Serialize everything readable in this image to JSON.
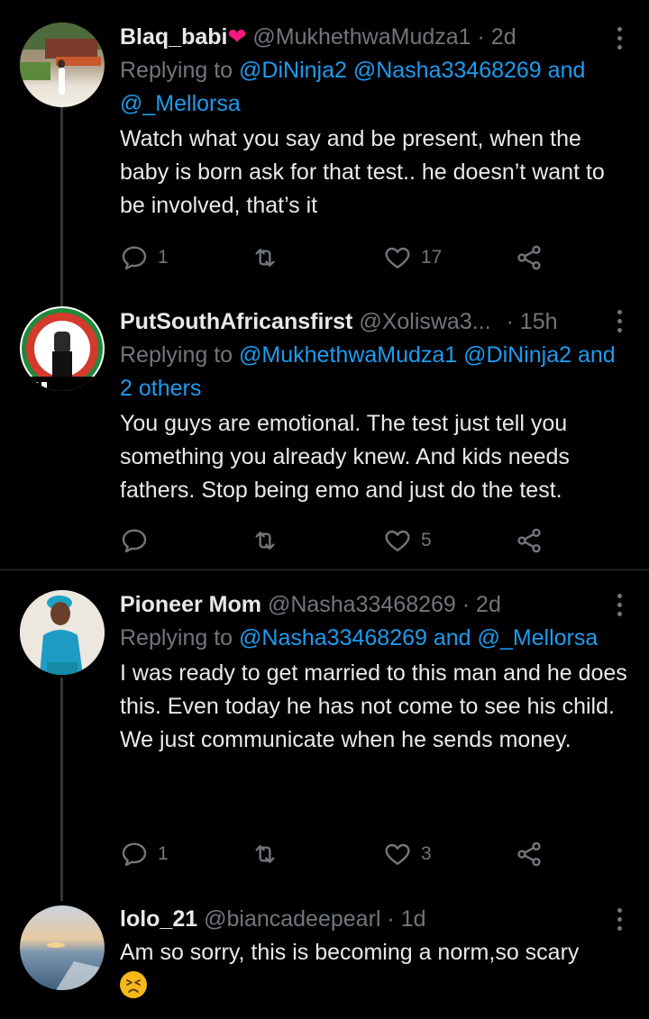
{
  "tweets": [
    {
      "name": "Blaq_babi",
      "heart": "❤️",
      "handle": "@MukhethwaMudza1",
      "time": "· 2d",
      "replying_prefix": "Replying to",
      "replying_mentions": "@DiNinja2 @Nasha33468269",
      "replying_and": "and",
      "replying_last": "@_Mellorsa",
      "text": "Watch what you say and be present, when the baby is born ask for that test.. he doesn’t want to be involved, that’s it",
      "replies": "1",
      "retweets": "",
      "likes": "17"
    },
    {
      "name": "PutSouthAfricansfirst",
      "handle": "@Xoliswa3...",
      "time": "· 15h",
      "replying_prefix": "Replying to",
      "replying_mentions": "@MukhethwaMudza1 @DiNinja2",
      "replying_and": "and",
      "replying_last": "2 others",
      "text": "You guys are emotional. The test just tell you something you already knew. And kids needs fathers. Stop being emo and just do the test.",
      "replies": "",
      "retweets": "",
      "likes": "5"
    },
    {
      "name": "Pioneer Mom",
      "handle": "@Nasha33468269",
      "time": "· 2d",
      "replying_prefix": "Replying to",
      "replying_mentions": "@Nasha33468269",
      "replying_and": "and",
      "replying_last": "@_Mellorsa",
      "text": "I was ready to get married to this man and he does this. Even today he has not come to see his child. We just communicate when he sends money.",
      "replies": "1",
      "retweets": "",
      "likes": "3"
    },
    {
      "name": "lolo_21",
      "handle": "@biancadeepearl",
      "time": "· 1d",
      "text": "Am so sorry, this is becoming a norm,so scary",
      "emoji": "😣"
    }
  ],
  "icons": {
    "reply": "reply-icon",
    "retweet": "retweet-icon",
    "like": "heart-icon",
    "share": "share-icon",
    "more": "more-icon"
  },
  "colors": {
    "background": "#000000",
    "text": "#e7e9ea",
    "secondary": "#71767b",
    "mention": "#1d9bf0",
    "heart": "#f91880"
  }
}
